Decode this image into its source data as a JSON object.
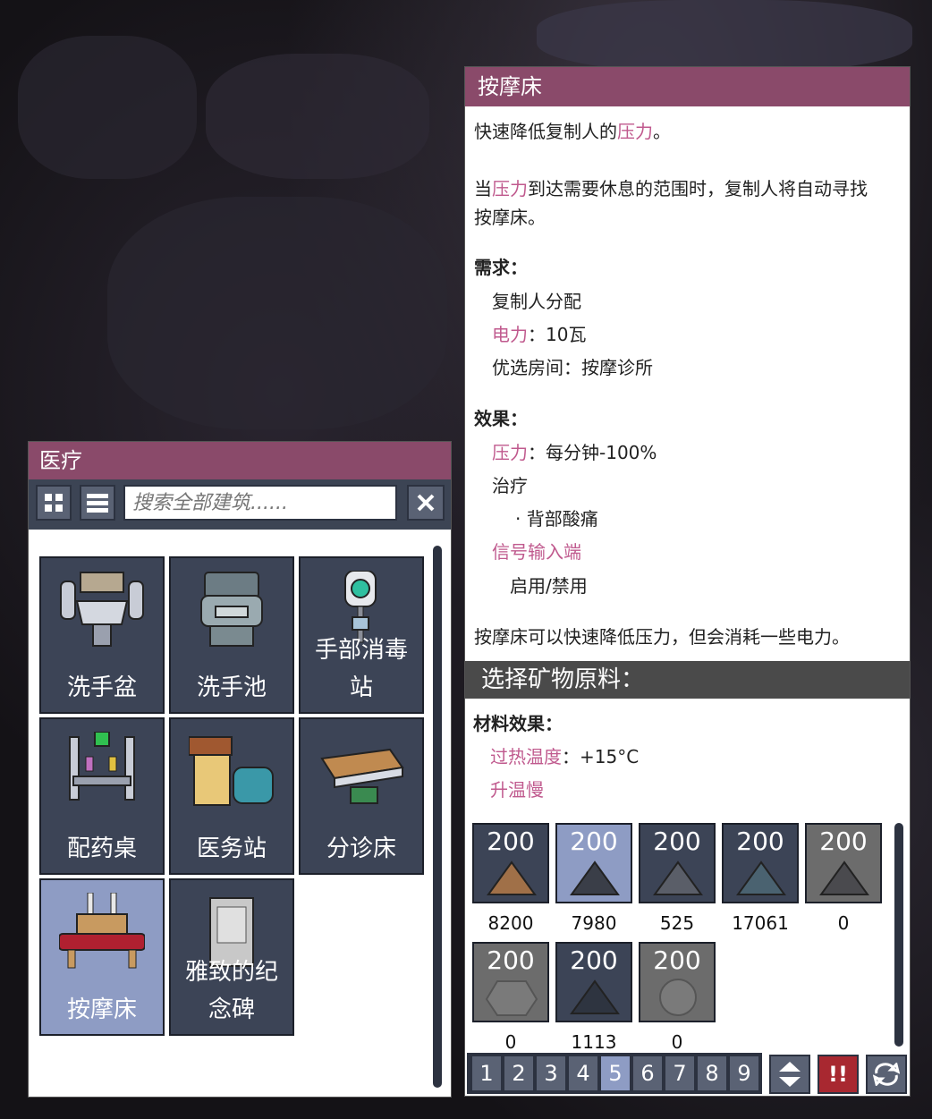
{
  "build_menu": {
    "title": "医疗",
    "search_placeholder": "搜索全部建筑......",
    "items": [
      {
        "label": "洗手盆"
      },
      {
        "label": "洗手池"
      },
      {
        "label": "手部消毒站"
      },
      {
        "label": "配药桌"
      },
      {
        "label": "医务站"
      },
      {
        "label": "分诊床"
      },
      {
        "label": "按摩床"
      },
      {
        "label": "雅致的纪念碑"
      }
    ],
    "selected_index": 6
  },
  "info": {
    "title": "按摩床",
    "desc1_pre": "快速降低复制人的",
    "desc1_link": "压力",
    "desc1_post": "。",
    "desc2_pre": "当",
    "desc2_link": "压力",
    "desc2_post": "到达需要休息的范围时，复制人将自动寻找",
    "desc2_line2": "按摩床。",
    "requirements_header": "需求：",
    "req_1": "复制人分配",
    "req_2_link": "电力",
    "req_2_value": "：10瓦",
    "req_3": "优选房间：按摩诊所",
    "effects_header": "效果：",
    "eff_1_link": "压力",
    "eff_1_value": "：每分钟-100%",
    "eff_2": "治疗",
    "eff_3": "· 背部酸痛",
    "eff_4_link": "信号输入端",
    "eff_5": "启用/禁用",
    "summary": "按摩床可以快速降低压力，但会消耗一些电力。"
  },
  "materials": {
    "header": "选择矿物原料：",
    "effects_header": "材料效果：",
    "eff_1_link": "过热温度",
    "eff_1_value": "：+15°C",
    "eff_2_link": "升温慢",
    "cost": "200",
    "counts": [
      "8200",
      "7980",
      "525",
      "17061",
      "0",
      "0",
      "1113",
      "0"
    ],
    "selected_index": 1
  },
  "priority_tabs": [
    "1",
    "2",
    "3",
    "4",
    "5",
    "6",
    "7",
    "8",
    "9"
  ],
  "active_priority": "5",
  "priority_buttons": {
    "urgent_label": "!!"
  }
}
